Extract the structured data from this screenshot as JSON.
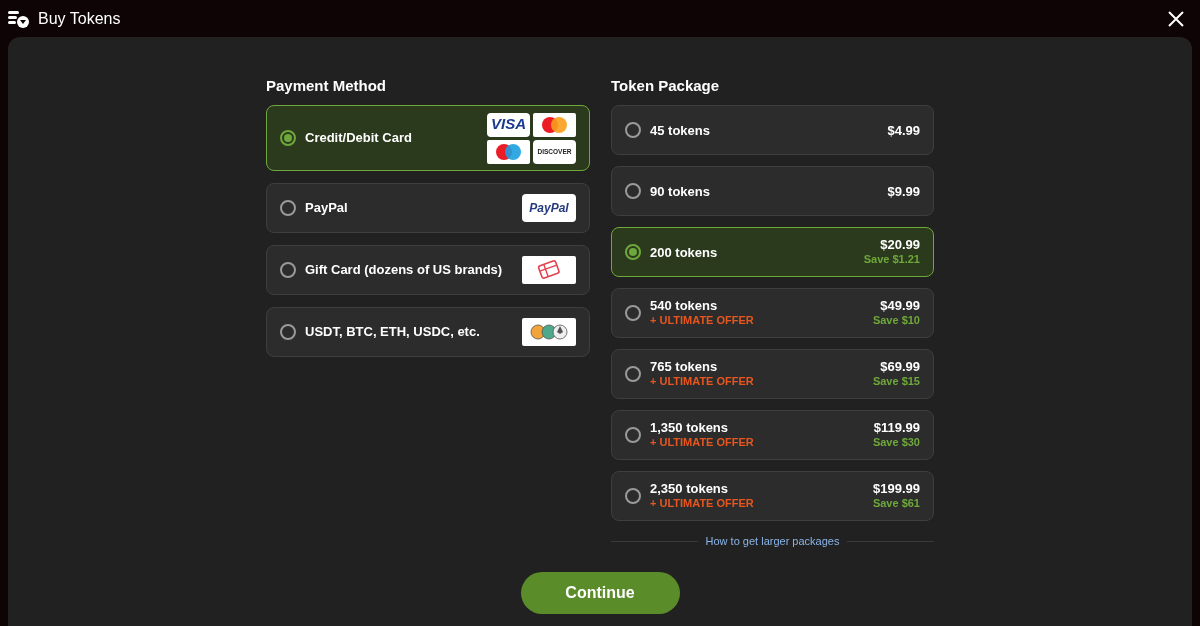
{
  "window": {
    "title": "Buy Tokens"
  },
  "payment": {
    "heading": "Payment Method",
    "methods": [
      {
        "label": "Credit/Debit Card",
        "selected": true,
        "logos": [
          {
            "kind": "visa",
            "text": "VISA"
          },
          {
            "kind": "mastercard"
          },
          {
            "kind": "maestro"
          },
          {
            "kind": "discover",
            "text": "DISCOVER"
          }
        ]
      },
      {
        "label": "PayPal",
        "selected": false,
        "logos": [
          {
            "kind": "paypal",
            "text": "PayPal"
          }
        ]
      },
      {
        "label": "Gift Card (dozens of US brands)",
        "selected": false,
        "logos": [
          {
            "kind": "gift"
          }
        ]
      },
      {
        "label": "USDT, BTC, ETH, USDC, etc.",
        "selected": false,
        "logos": [
          {
            "kind": "crypto"
          }
        ]
      }
    ]
  },
  "packages": {
    "heading": "Token Package",
    "items": [
      {
        "tokens": "45 tokens",
        "price": "$4.99",
        "selected": false
      },
      {
        "tokens": "90 tokens",
        "price": "$9.99",
        "selected": false
      },
      {
        "tokens": "200 tokens",
        "price": "$20.99",
        "save": "Save $1.21",
        "selected": true
      },
      {
        "tokens": "540 tokens",
        "offer": "+ ULTIMATE OFFER",
        "price": "$49.99",
        "save": "Save $10",
        "selected": false
      },
      {
        "tokens": "765 tokens",
        "offer": "+ ULTIMATE OFFER",
        "price": "$69.99",
        "save": "Save $15",
        "selected": false
      },
      {
        "tokens": "1,350 tokens",
        "offer": "+ ULTIMATE OFFER",
        "price": "$119.99",
        "save": "Save $30",
        "selected": false
      },
      {
        "tokens": "2,350 tokens",
        "offer": "+ ULTIMATE OFFER",
        "price": "$199.99",
        "save": "Save $61",
        "selected": false
      }
    ],
    "link": "How to get larger packages"
  },
  "continue_button": "Continue"
}
